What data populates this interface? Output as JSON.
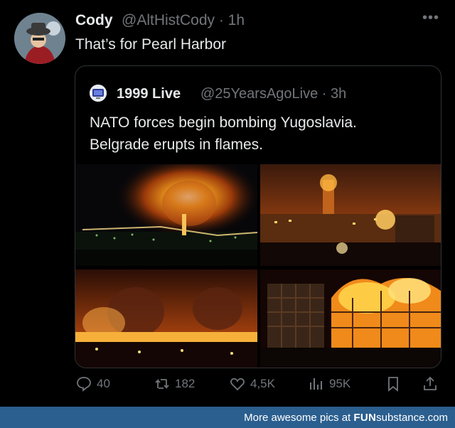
{
  "tweet": {
    "author_name": "Cody",
    "author_handle": "@AltHistCody",
    "time": "· 1h",
    "text": "That’s for Pearl Harbor"
  },
  "quoted": {
    "author_name": "1999 Live",
    "author_handle": "@25YearsAgoLive",
    "time": "· 3h",
    "line1": "NATO forces begin bombing Yugoslavia.",
    "line2": "Belgrade erupts in flames."
  },
  "actions": {
    "replies": "40",
    "reposts": "182",
    "likes": "4,5K",
    "views": "95K"
  },
  "footer": {
    "prefix": "More awesome pics at",
    "brand_bold": "FUN",
    "brand_rest": "substance.com"
  },
  "icons": [
    "more-icon",
    "reply-icon",
    "repost-icon",
    "like-icon",
    "views-icon",
    "bookmark-icon",
    "share-icon"
  ],
  "colors": {
    "background": "#000000",
    "muted": "#71767b",
    "text": "#e7e9ea",
    "footer": "#2b5f8f"
  }
}
